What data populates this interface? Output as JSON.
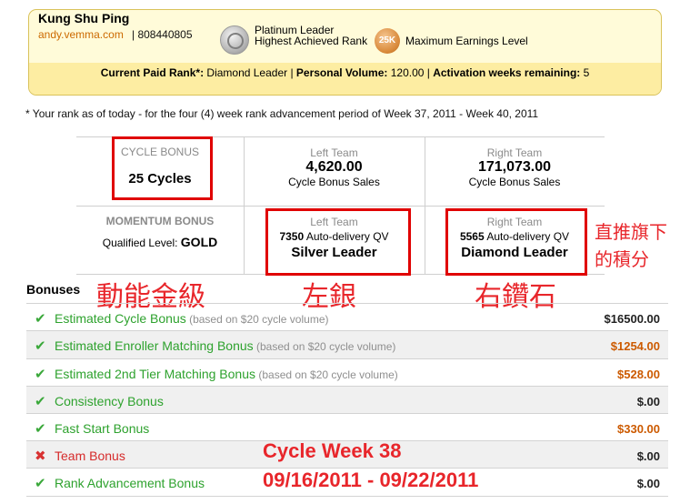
{
  "member": {
    "name": "Kung Shu Ping",
    "site": "andy.vemma.com",
    "separator": " | ",
    "id": "808440805",
    "highest_rank_line1": "Platinum Leader",
    "highest_rank_line2": "Highest Achieved Rank",
    "earnings_badge": "25K",
    "earnings_label": "Maximum Earnings Level"
  },
  "status": {
    "paid_rank_label": "Current Paid Rank*:",
    "paid_rank_value": " Diamond Leader | ",
    "pv_label": "Personal Volume:",
    "pv_value": " 120.00 | ",
    "weeks_label": "Activation weeks remaining:",
    "weeks_value": " 5"
  },
  "rank_note": "* Your rank as of today - for the four (4) week rank advancement period of Week 37, 2011 - Week 40, 2011",
  "grid": {
    "cycle_bonus_title": "CYCLE BONUS",
    "cycle_bonus_value": "25 Cycles",
    "left_team_title": "Left Team",
    "left_sales": "4,620.00",
    "sales_caption": "Cycle Bonus Sales",
    "right_team_title": "Right Team",
    "right_sales": "171,073.00",
    "momentum_title": "MOMENTUM BONUS",
    "qualified_label": "Qualified Level: ",
    "qualified_value": "GOLD",
    "left_qv_num": "7350",
    "qv_caption": " Auto-delivery QV",
    "left_rank": "Silver Leader",
    "right_qv_num": "5565",
    "right_rank": "Diamond Leader"
  },
  "annotations": {
    "personal_points_1": "直推旗下",
    "personal_points_2": "的積分",
    "momentum_gold": "動能金級",
    "left_silver": "左銀",
    "right_diamond": "右鑽石",
    "cycle_week": "Cycle Week 38",
    "cycle_dates": "09/16/2011 - 09/22/2011",
    "color": "#e8262b"
  },
  "bonuses": {
    "title": "Bonuses",
    "rows": [
      {
        "label": "Estimated Cycle Bonus",
        "hint": " (based on $20 cycle volume)",
        "amount": "$16500.00",
        "status": "check"
      },
      {
        "label": "Estimated Enroller Matching Bonus",
        "hint": " (based on $20 cycle volume)",
        "amount": "$1254.00",
        "status": "check"
      },
      {
        "label": "Estimated 2nd Tier Matching Bonus",
        "hint": " (based on $20 cycle volume)",
        "amount": "$528.00",
        "status": "check"
      },
      {
        "label": "Consistency Bonus",
        "hint": "",
        "amount": "$.00",
        "status": "check"
      },
      {
        "label": "Fast Start Bonus",
        "hint": "",
        "amount": "$330.00",
        "status": "check"
      },
      {
        "label": "Team Bonus",
        "hint": "",
        "amount": "$.00",
        "status": "x"
      },
      {
        "label": "Rank Advancement Bonus",
        "hint": "",
        "amount": "$.00",
        "status": "check"
      }
    ],
    "icons": {
      "check": "check-icon",
      "x": "x-icon"
    }
  }
}
